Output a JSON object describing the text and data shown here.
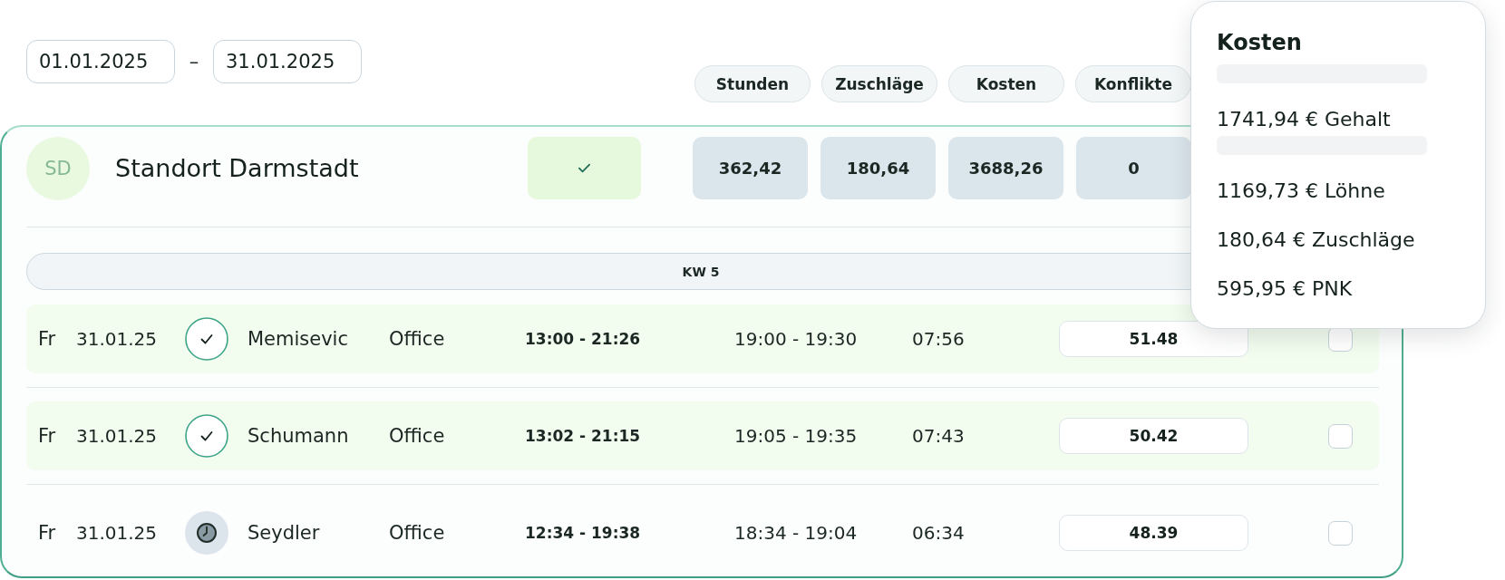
{
  "date_range": {
    "from": "01.01.2025",
    "separator": "–",
    "to": "31.01.2025"
  },
  "columns": [
    {
      "label": "Stunden"
    },
    {
      "label": "Zuschläge"
    },
    {
      "label": "Kosten"
    },
    {
      "label": "Konflikte"
    }
  ],
  "location": {
    "initials": "SD",
    "name": "Standort Darmstadt",
    "approved": true,
    "totals": [
      "362,42",
      "180,64",
      "3688,26",
      "0"
    ]
  },
  "week": {
    "label": "KW 5"
  },
  "rows": [
    {
      "day": "Fr",
      "date": "31.01.25",
      "approved": true,
      "name": "Memisevic",
      "area": "Office",
      "shift_time": "13:00 - 21:26",
      "break_time": "19:00 - 19:30",
      "net_time": "07:56",
      "amount": "51.48",
      "checked": false
    },
    {
      "day": "Fr",
      "date": "31.01.25",
      "approved": true,
      "name": "Schumann",
      "area": "Office",
      "shift_time": "13:02 - 21:15",
      "break_time": "19:05 - 19:35",
      "net_time": "07:43",
      "amount": "50.42",
      "checked": false
    },
    {
      "day": "Fr",
      "date": "31.01.25",
      "approved": false,
      "name": "Seydler",
      "area": "Office",
      "shift_time": "12:34 - 19:38",
      "break_time": "18:34 - 19:04",
      "net_time": "06:34",
      "amount": "48.39",
      "checked": false
    }
  ],
  "cost_popup": {
    "title": "Kosten",
    "items": [
      {
        "kind": "skeleton"
      },
      {
        "kind": "line",
        "text": "1741,94 € Gehalt"
      },
      {
        "kind": "skeleton"
      },
      {
        "kind": "line",
        "text": "1169,73 € Löhne"
      },
      {
        "kind": "line",
        "text": "180,64 € Zuschläge"
      },
      {
        "kind": "line",
        "text": "595,95 € PNK"
      }
    ]
  }
}
